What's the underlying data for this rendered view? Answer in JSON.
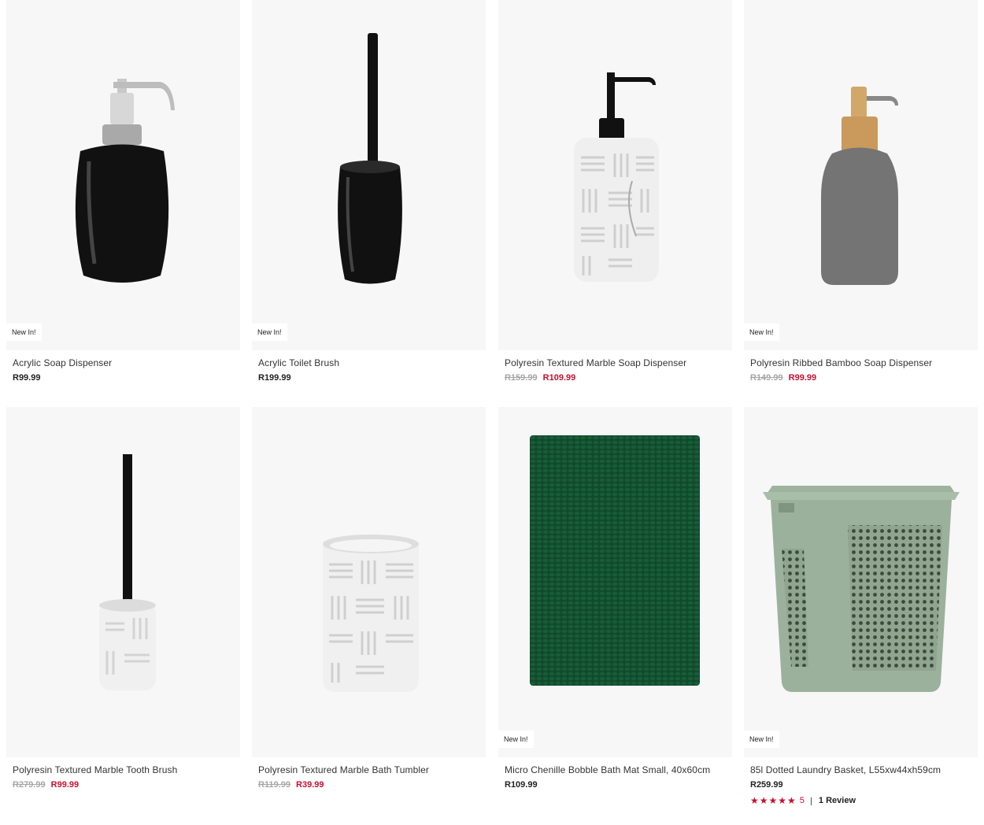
{
  "products": [
    {
      "badge": "New In!",
      "name": "Acrylic Soap Dispenser",
      "price": "R99.99",
      "old_price": "",
      "sale_price": ""
    },
    {
      "badge": "New In!",
      "name": "Acrylic Toilet Brush",
      "price": "R199.99",
      "old_price": "",
      "sale_price": ""
    },
    {
      "badge": "",
      "name": "Polyresin Textured Marble Soap Dispenser",
      "price": "",
      "old_price": "R159.99",
      "sale_price": "R109.99"
    },
    {
      "badge": "New In!",
      "name": "Polyresin Ribbed Bamboo Soap Dispenser",
      "price": "",
      "old_price": "R149.99",
      "sale_price": "R99.99"
    },
    {
      "badge": "",
      "name": "Polyresin Textured Marble Tooth Brush",
      "price": "",
      "old_price": "R279.99",
      "sale_price": "R99.99"
    },
    {
      "badge": "",
      "name": "Polyresin Textured Marble Bath Tumbler",
      "price": "",
      "old_price": "R119.99",
      "sale_price": "R39.99"
    },
    {
      "badge": "New In!",
      "name": "Micro Chenille Bobble Bath Mat Small, 40x60cm",
      "price": "R109.99",
      "old_price": "",
      "sale_price": ""
    },
    {
      "badge": "New In!",
      "name": "85l Dotted Laundry Basket, L55xw44xh59cm",
      "price": "R259.99",
      "old_price": "",
      "sale_price": "",
      "rating": {
        "stars": "★★★★★",
        "score": "5",
        "reviews": "1 Review",
        "value": 5
      }
    }
  ],
  "colors": {
    "sale": "#c8102e",
    "old_price": "#a6a6a6",
    "card_bg": "#f7f7f7"
  },
  "icons": {
    "rating": "star-icon"
  }
}
